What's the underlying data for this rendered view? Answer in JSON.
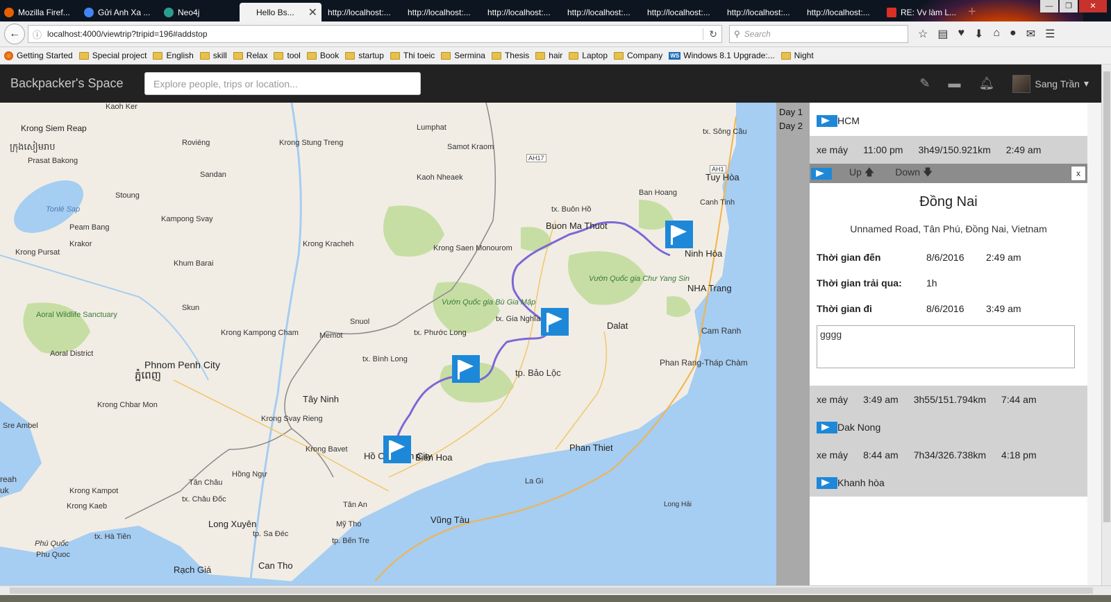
{
  "tabs": [
    {
      "label": "Mozilla Firef...",
      "color": "#e66000"
    },
    {
      "label": "Gửi Anh Xa ...",
      "color": "#4285f4"
    },
    {
      "label": "Neo4j",
      "color": "#2a9d8f"
    },
    {
      "label": "Hello Bs...",
      "color": "#888888",
      "active": true
    },
    {
      "label": "http://localhost:...",
      "color": ""
    },
    {
      "label": "http://localhost:...",
      "color": ""
    },
    {
      "label": "http://localhost:...",
      "color": ""
    },
    {
      "label": "http://localhost:...",
      "color": ""
    },
    {
      "label": "http://localhost:...",
      "color": ""
    },
    {
      "label": "http://localhost:...",
      "color": ""
    },
    {
      "label": "http://localhost:...",
      "color": ""
    },
    {
      "label": "RE: Vv làm L...",
      "color": "#d93025"
    }
  ],
  "browser": {
    "url": "localhost:4000/viewtrip?tripid=196#addstop",
    "search_placeholder": "Search",
    "new_tab": "+",
    "close_tab": "✕"
  },
  "bookmarks": [
    {
      "label": "Getting Started",
      "icon": "firefox"
    },
    {
      "label": "Special project",
      "icon": "folder"
    },
    {
      "label": "English",
      "icon": "folder"
    },
    {
      "label": "skill",
      "icon": "folder"
    },
    {
      "label": "Relax",
      "icon": "folder"
    },
    {
      "label": "tool",
      "icon": "folder"
    },
    {
      "label": "Book",
      "icon": "folder"
    },
    {
      "label": "startup",
      "icon": "folder"
    },
    {
      "label": "Thi toeic",
      "icon": "folder"
    },
    {
      "label": "Sermina",
      "icon": "folder"
    },
    {
      "label": "Thesis",
      "icon": "folder"
    },
    {
      "label": "hair",
      "icon": "folder"
    },
    {
      "label": "Laptop",
      "icon": "folder"
    },
    {
      "label": "Company",
      "icon": "folder"
    },
    {
      "label": "Windows 8.1 Upgrade:...",
      "icon": "ws"
    },
    {
      "label": "Night",
      "icon": "folder"
    }
  ],
  "app": {
    "brand": "Backpacker's Space",
    "explore_placeholder": "Explore people, trips or location...",
    "user_name": "Sang Trần"
  },
  "map": {
    "labels": [
      {
        "text": "Kaoh Ker"
      },
      {
        "text": "Krong Siem Reap"
      },
      {
        "text": "ក្រុងសៀមរាប"
      },
      {
        "text": "Prasat Bakong"
      },
      {
        "text": "Roviéng"
      },
      {
        "text": "Krong Stung Treng"
      },
      {
        "text": "Lumphat"
      },
      {
        "text": "Samot Kraom"
      },
      {
        "text": "Kaoh Nheaek"
      },
      {
        "text": "Sandan"
      },
      {
        "text": "Stoung"
      },
      {
        "text": "Tonlé Sap"
      },
      {
        "text": "Peam Bang"
      },
      {
        "text": "Kampong Svay"
      },
      {
        "text": "Krong Pursat"
      },
      {
        "text": "Krakor"
      },
      {
        "text": "Krong Kracheh"
      },
      {
        "text": "Krong Saen Monourom"
      },
      {
        "text": "Buon Ma Thuot"
      },
      {
        "text": "tx. Buôn Hồ"
      },
      {
        "text": "Ban Hoang"
      },
      {
        "text": "Canh Tinh"
      },
      {
        "text": "tx. Sông Cầu"
      },
      {
        "text": "Tuy Hòa"
      },
      {
        "text": "Ninh Hòa"
      },
      {
        "text": "NHA Trang"
      },
      {
        "text": "Cam Ranh"
      },
      {
        "text": "Phan Rang-Tháp Chàm"
      },
      {
        "text": "Dalat"
      },
      {
        "text": "Vườn Quốc gia Chư Yang Sin"
      },
      {
        "text": "Vườn Quốc gia Bù Gia Mập"
      },
      {
        "text": "tx. Gia Nghĩa"
      },
      {
        "text": "tx. Phước Long"
      },
      {
        "text": "Snuol"
      },
      {
        "text": "Memot"
      },
      {
        "text": "tx. Bình Long"
      },
      {
        "text": "tp. Bảo Lộc"
      },
      {
        "text": "Krong Kampong Cham"
      },
      {
        "text": "Khum Barai"
      },
      {
        "text": "Skun"
      },
      {
        "text": "Aoral Wildlife Sanctuary"
      },
      {
        "text": "Phnom Penh City"
      },
      {
        "text": "ភ្នំពេញ"
      },
      {
        "text": "Aoral District"
      },
      {
        "text": "Tây Ninh"
      },
      {
        "text": "Krong Svay Rieng"
      },
      {
        "text": "Krong Bavet"
      },
      {
        "text": "Krong Chbar Mon"
      },
      {
        "text": "Sre Ambel"
      },
      {
        "text": "Hồ Chí Minh City"
      },
      {
        "text": "Bien Hoa"
      },
      {
        "text": "Phan Thiet"
      },
      {
        "text": "La Gi"
      },
      {
        "text": "Hồng Ngự"
      },
      {
        "text": "tx. Châu Đốc"
      },
      {
        "text": "Tân Châu"
      },
      {
        "text": "Krong Kampot"
      },
      {
        "text": "Krong Kaeb"
      },
      {
        "text": "Long Xuyên"
      },
      {
        "text": "Mỹ Tho"
      },
      {
        "text": "Tân An"
      },
      {
        "text": "Vũng Tàu"
      },
      {
        "text": "tp. Sa Đéc"
      },
      {
        "text": "tp. Bến Tre"
      },
      {
        "text": "tx. Hà Tiên"
      },
      {
        "text": "Phú Quốc"
      },
      {
        "text": "Phu Quoc"
      },
      {
        "text": "Rạch Giá"
      },
      {
        "text": "Can Tho"
      },
      {
        "text": "Long Hải"
      },
      {
        "text": "AH17"
      },
      {
        "text": "AH1"
      },
      {
        "text": "reah"
      },
      {
        "text": "uk"
      }
    ]
  },
  "sidebar": {
    "days": [
      "Day 1",
      "Day 2"
    ],
    "first_stop": "HCM",
    "leg1": {
      "vehicle": "xe máy",
      "depart": "11:00 pm",
      "dur_dist": "3h49/150.921km",
      "arrive": "2:49 am"
    },
    "stop_controls": {
      "up": "Up",
      "down": "Down",
      "close": "x"
    },
    "stop": {
      "name": "Đồng Nai",
      "address": "Unnamed Road, Tân Phú, Đồng Nai, Vietnam",
      "arrival_label": "Thời gian đến",
      "arrival_date": "8/6/2016",
      "arrival_time": "2:49 am",
      "spent_label": "Thời gian trải qua:",
      "spent_value": "1h",
      "departure_label": "Thời gian đi",
      "departure_date": "8/6/2016",
      "departure_time": "3:49 am",
      "note": "gggg"
    },
    "leg2": {
      "vehicle": "xe máy",
      "depart": "3:49 am",
      "dur_dist": "3h55/151.794km",
      "arrive": "7:44 am"
    },
    "second_stop": "Dak Nong",
    "leg3": {
      "vehicle": "xe máy",
      "depart": "8:44 am",
      "dur_dist": "7h34/326.738km",
      "arrive": "4:18 pm"
    },
    "third_stop": "Khanh hòa"
  },
  "colors": {
    "flag_blue": "#1e88d8",
    "route_purple": "#7b68d6",
    "water": "#a6cdf2",
    "park_green": "#c6dea4"
  }
}
